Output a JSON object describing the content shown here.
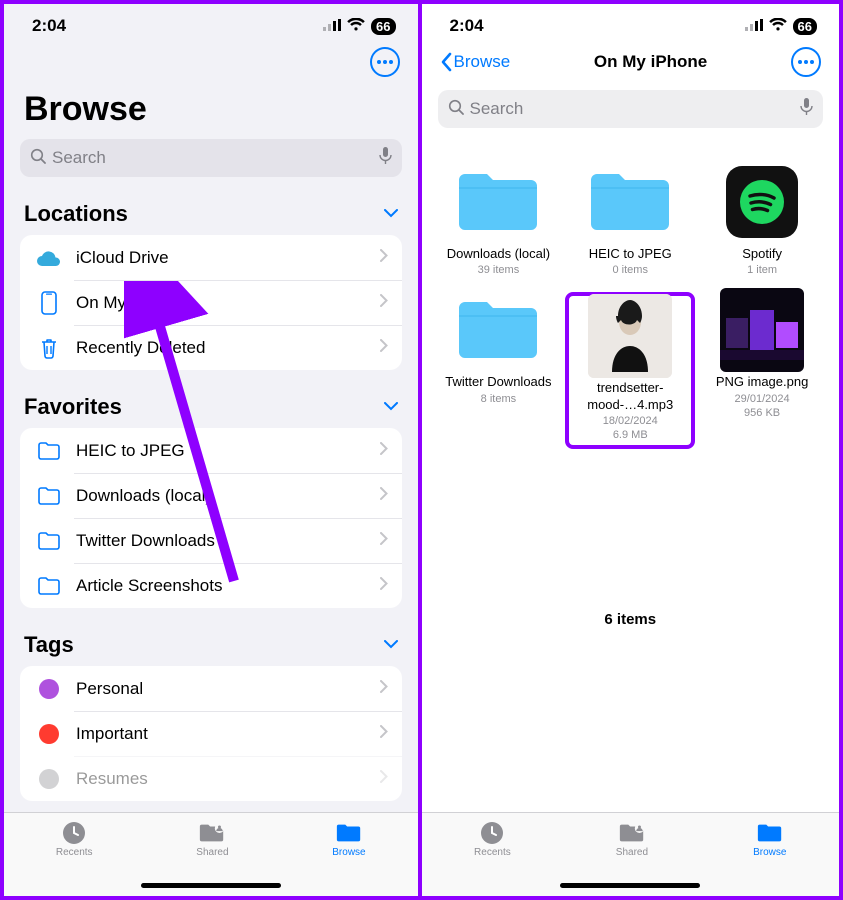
{
  "status": {
    "time": "2:04",
    "battery": "66"
  },
  "phone1": {
    "more_label": "…",
    "large_title": "Browse",
    "search_placeholder": "Search",
    "sections": {
      "locations": {
        "title": "Locations",
        "items": [
          {
            "label": "iCloud Drive",
            "icon": "cloud"
          },
          {
            "label": "On My iPhone",
            "icon": "phone"
          },
          {
            "label": "Recently Deleted",
            "icon": "trash"
          }
        ]
      },
      "favorites": {
        "title": "Favorites",
        "items": [
          {
            "label": "HEIC to JPEG"
          },
          {
            "label": "Downloads (local)"
          },
          {
            "label": "Twitter Downloads"
          },
          {
            "label": "Article Screenshots"
          }
        ]
      },
      "tags": {
        "title": "Tags",
        "items": [
          {
            "label": "Personal",
            "color": "#af52de"
          },
          {
            "label": "Important",
            "color": "#ff3b30"
          },
          {
            "label": "Resumes",
            "color": "#8e8e93"
          }
        ]
      }
    },
    "tabs": {
      "recents": "Recents",
      "shared": "Shared",
      "browse": "Browse"
    }
  },
  "phone2": {
    "back_label": "Browse",
    "title": "On My iPhone",
    "search_placeholder": "Search",
    "items_footer": "6 items",
    "grid": [
      {
        "type": "folder",
        "name": "Downloads (local)",
        "meta": "39 items"
      },
      {
        "type": "folder",
        "name": "HEIC to JPEG",
        "meta": "0 items"
      },
      {
        "type": "app",
        "name": "Spotify",
        "meta": "1 item"
      },
      {
        "type": "folder",
        "name": "Twitter Downloads",
        "meta": "8 items"
      },
      {
        "type": "file",
        "name": "trendsetter-mood-…4.mp3",
        "date": "18/02/2024",
        "size": "6.9 MB",
        "highlighted": true
      },
      {
        "type": "image",
        "name": "PNG image.png",
        "date": "29/01/2024",
        "size": "956 KB"
      }
    ],
    "tabs": {
      "recents": "Recents",
      "shared": "Shared",
      "browse": "Browse"
    }
  }
}
